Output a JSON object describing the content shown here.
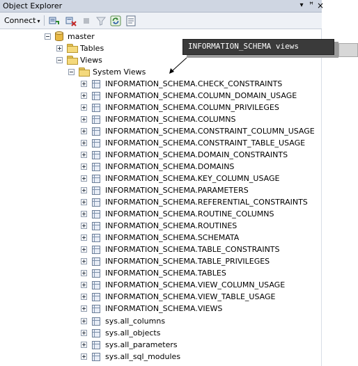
{
  "panel": {
    "title": "Object Explorer",
    "pin_glyph": "▾",
    "dock_glyph": "ꟸ",
    "close_glyph": "×"
  },
  "toolbar": {
    "connect_label": "Connect",
    "connect_arrow": "▾"
  },
  "tree": {
    "master": "master",
    "tables": "Tables",
    "views": "Views",
    "system_views": "System Views",
    "items": [
      "INFORMATION_SCHEMA.CHECK_CONSTRAINTS",
      "INFORMATION_SCHEMA.COLUMN_DOMAIN_USAGE",
      "INFORMATION_SCHEMA.COLUMN_PRIVILEGES",
      "INFORMATION_SCHEMA.COLUMNS",
      "INFORMATION_SCHEMA.CONSTRAINT_COLUMN_USAGE",
      "INFORMATION_SCHEMA.CONSTRAINT_TABLE_USAGE",
      "INFORMATION_SCHEMA.DOMAIN_CONSTRAINTS",
      "INFORMATION_SCHEMA.DOMAINS",
      "INFORMATION_SCHEMA.KEY_COLUMN_USAGE",
      "INFORMATION_SCHEMA.PARAMETERS",
      "INFORMATION_SCHEMA.REFERENTIAL_CONSTRAINTS",
      "INFORMATION_SCHEMA.ROUTINE_COLUMNS",
      "INFORMATION_SCHEMA.ROUTINES",
      "INFORMATION_SCHEMA.SCHEMATA",
      "INFORMATION_SCHEMA.TABLE_CONSTRAINTS",
      "INFORMATION_SCHEMA.TABLE_PRIVILEGES",
      "INFORMATION_SCHEMA.TABLES",
      "INFORMATION_SCHEMA.VIEW_COLUMN_USAGE",
      "INFORMATION_SCHEMA.VIEW_TABLE_USAGE",
      "INFORMATION_SCHEMA.VIEWS",
      "sys.all_columns",
      "sys.all_objects",
      "sys.all_parameters",
      "sys.all_sql_modules"
    ]
  },
  "callout": {
    "text": "INFORMATION_SCHEMA views"
  },
  "colors": {
    "titlebar": "#cfd6e2",
    "toolbar": "#eef1f6",
    "callout_bg": "#3a3a3a",
    "folder": "#f4d97c"
  }
}
